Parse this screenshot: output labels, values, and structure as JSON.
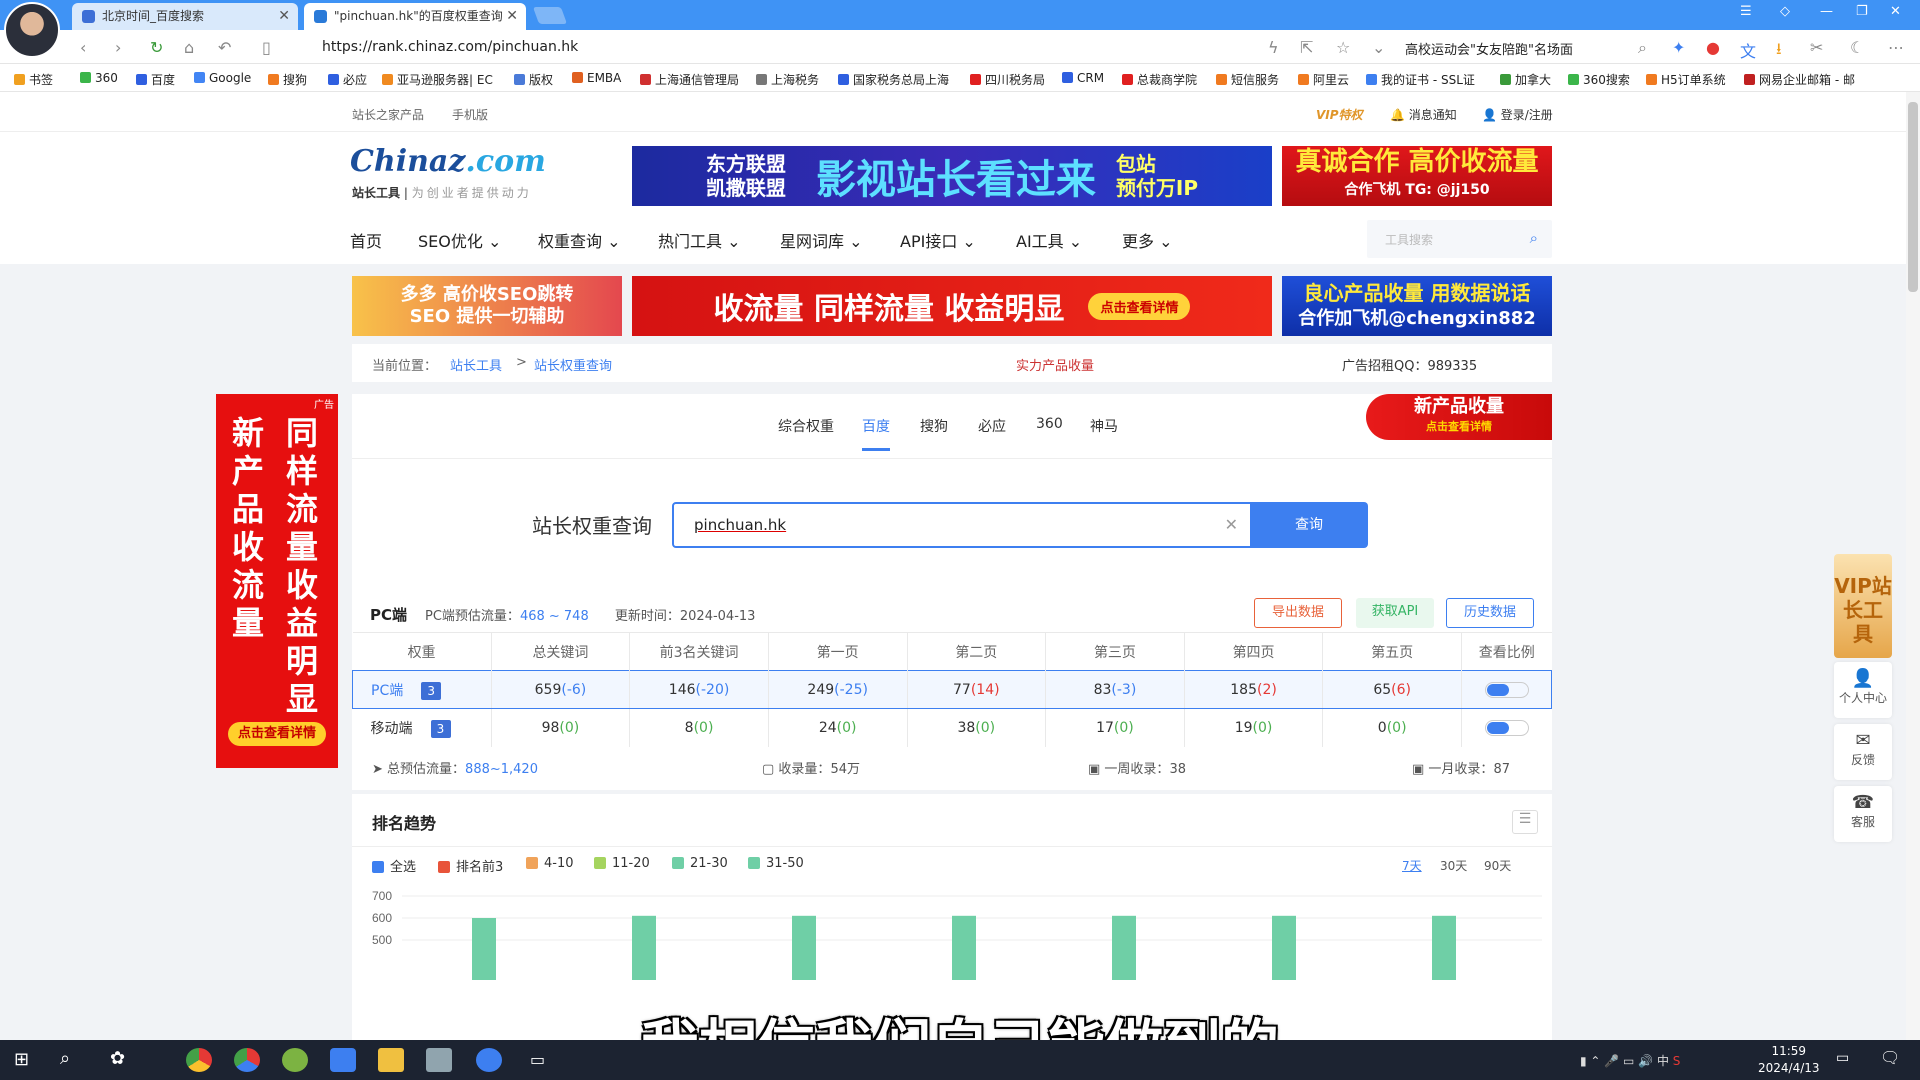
{
  "browser": {
    "tabs": [
      {
        "label": "北京时间_百度搜索"
      },
      {
        "label": "\"pinchuan.hk\"的百度权重查询"
      }
    ],
    "url": "https://rank.chinaz.com/pinchuan.hk",
    "hot_news": "高校运动会\"女友陪跑\"名场面",
    "bookmarks": [
      "书签",
      "360",
      "百度",
      "Google",
      "搜狗",
      "必应",
      "亚马逊服务器| EC",
      "版权",
      "EMBA",
      "上海通信管理局",
      "上海税务",
      "国家税务总局上海",
      "四川税务局",
      "CRM",
      "总裁商学院",
      "短信服务",
      "阿里云",
      "我的证书 - SSL证",
      "加拿大",
      "360搜索",
      "H5订单系统",
      "网易企业邮箱 - 邮"
    ]
  },
  "topbar": {
    "products": "站长之家产品",
    "mobile": "手机版",
    "vip": "VIP特权",
    "notify": "消息通知",
    "login": "登录/注册"
  },
  "logo": {
    "main": "Chinaz",
    "com": ".com",
    "sub1": "站长工具",
    "sub2": "为创业者提供动力"
  },
  "ads": {
    "ad1_left": "东方联盟\n凯撒联盟",
    "ad1_main": "影视站长看过来",
    "ad1_right": "包站\n预付万IP",
    "ad_tag": "广告",
    "ad2_main": "真诚合作 高价收流量",
    "ad2_sub": "合作飞机 TG: @jj150",
    "ad3_line1": "多多 高价收SEO跳转",
    "ad3_line2": "SEO 提供一切辅助",
    "ad4_main": "收流量 同样流量 收益明显",
    "ad4_btn": "点击查看详情",
    "ad5_line1": "良心产品收量 用数据说话",
    "ad5_line2": "合作加飞机@chengxin882",
    "left_col1": "新产品收流量",
    "left_col2": "同样流量收益明显",
    "left_btn": "点击查看详情",
    "newprod_main": "新产品收量",
    "newprod_sub": "点击查看详情"
  },
  "nav": [
    "首页",
    "SEO优化",
    "权重查询",
    "热门工具",
    "星网词库",
    "API接口",
    "AI工具",
    "更多"
  ],
  "tool_search_placeholder": "工具搜索",
  "breadcrumb": {
    "label": "当前位置：",
    "item1": "站长工具",
    "sep": ">",
    "item2": "站长权重查询",
    "promo": "实力产品收量",
    "adqq": "广告招租QQ：989335"
  },
  "search_tabs": [
    "综合权重",
    "百度",
    "搜狗",
    "必应",
    "360",
    "神马"
  ],
  "search": {
    "label": "站长权重查询",
    "value": "pinchuan.hk",
    "button": "查询"
  },
  "pc_info": {
    "title": "PC端",
    "traffic_label": "PC端预估流量：",
    "traffic": "468 ~ 748",
    "update_label": "更新时间：",
    "update": "2024-04-13"
  },
  "actions": {
    "export": "导出数据",
    "api": "获取API",
    "history": "历史数据"
  },
  "table": {
    "headers": [
      "权重",
      "总关键词",
      "前3名关键词",
      "第一页",
      "第二页",
      "第三页",
      "第四页",
      "第五页",
      "查看比例"
    ],
    "rows": [
      {
        "name": "PC端",
        "weight": "3",
        "cells": [
          [
            "659",
            "(-6)"
          ],
          [
            "146",
            "(-20)"
          ],
          [
            "249",
            "(-25)"
          ],
          [
            "77",
            "(14)"
          ],
          [
            "83",
            "(-3)"
          ],
          [
            "185",
            "(2)"
          ],
          [
            "65",
            "(6)"
          ]
        ]
      },
      {
        "name": "移动端",
        "weight": "3",
        "cells": [
          [
            "98",
            "(0)"
          ],
          [
            "8",
            "(0)"
          ],
          [
            "24",
            "(0)"
          ],
          [
            "38",
            "(0)"
          ],
          [
            "17",
            "(0)"
          ],
          [
            "19",
            "(0)"
          ],
          [
            "0",
            "(0)"
          ]
        ]
      }
    ]
  },
  "summary": {
    "total_label": "总预估流量：",
    "total": "888~1,420",
    "index_label": "收录量：",
    "index": "54万",
    "week_label": "一周收录：",
    "week": "38",
    "month_label": "一月收录：",
    "month": "87"
  },
  "trend": {
    "title": "排名趋势",
    "legend": [
      "全选",
      "排名前3",
      "4-10",
      "11-20",
      "21-30",
      "31-50"
    ],
    "ranges": [
      "7天",
      "30天",
      "90天"
    ]
  },
  "chart_data": {
    "type": "bar",
    "y_ticks": [
      700,
      600,
      500
    ],
    "visible_values": [
      600,
      610,
      610,
      610,
      610,
      610,
      610
    ],
    "legend_colors": {
      "全选": "#3d7ff0",
      "排名前3": "#e8543a",
      "4-10": "#f0a35a",
      "11-20": "#a5d45f",
      "21-30": "#6fcfa6",
      "31-50": "#6fcfa6"
    }
  },
  "side": {
    "vip": "VIP站长工具",
    "personal": "个人中心",
    "feedback": "反馈",
    "service": "客服"
  },
  "subtitle": "我相信我们自己能做到的",
  "taskbar": {
    "time": "11:59",
    "date": "2024/4/13",
    "ime": "中"
  }
}
